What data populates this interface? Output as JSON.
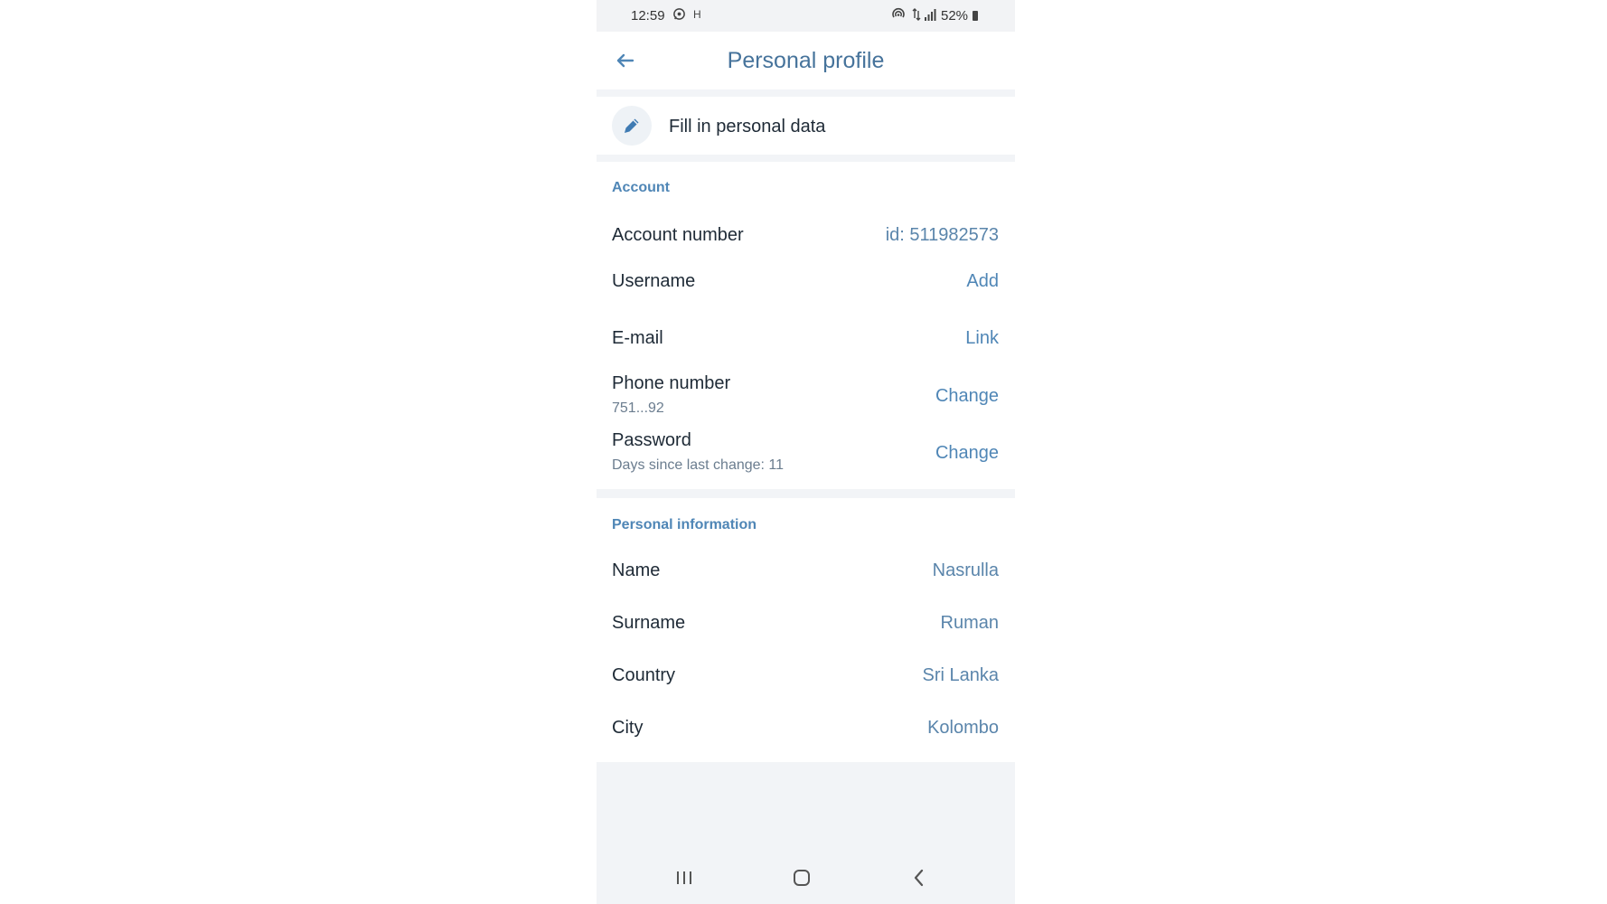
{
  "status_bar": {
    "time": "12:59",
    "carrier_indicator": "H",
    "battery": "52%",
    "icons": [
      "whatsapp-icon",
      "hotspot-icon",
      "data-arrows-icon",
      "signal-icon",
      "battery-icon"
    ]
  },
  "header": {
    "title": "Personal profile",
    "back_icon": "back-arrow-icon"
  },
  "fill_in": {
    "label": "Fill in personal data",
    "icon": "pencil-icon"
  },
  "account": {
    "section_title": "Account",
    "rows": [
      {
        "label": "Account number",
        "value": "id: 511982573"
      },
      {
        "label": "Username",
        "value": "Add"
      },
      {
        "label": "E-mail",
        "value": "Link"
      },
      {
        "label": "Phone number",
        "sub": "751...92",
        "value": "Change"
      },
      {
        "label": "Password",
        "sub": "Days since last change: 11",
        "value": "Change"
      }
    ]
  },
  "personal": {
    "section_title": "Personal information",
    "rows": [
      {
        "label": "Name",
        "value": "Nasrulla"
      },
      {
        "label": "Surname",
        "value": "Ruman"
      },
      {
        "label": "Country",
        "value": "Sri Lanka"
      },
      {
        "label": "City",
        "value": "Kolombo"
      }
    ]
  },
  "nav_bar": {
    "icons": [
      "recent-apps-icon",
      "home-icon",
      "back-icon"
    ]
  },
  "colors": {
    "accent": "#4f86b6",
    "title": "#46739b",
    "background": "#f2f4f7"
  }
}
